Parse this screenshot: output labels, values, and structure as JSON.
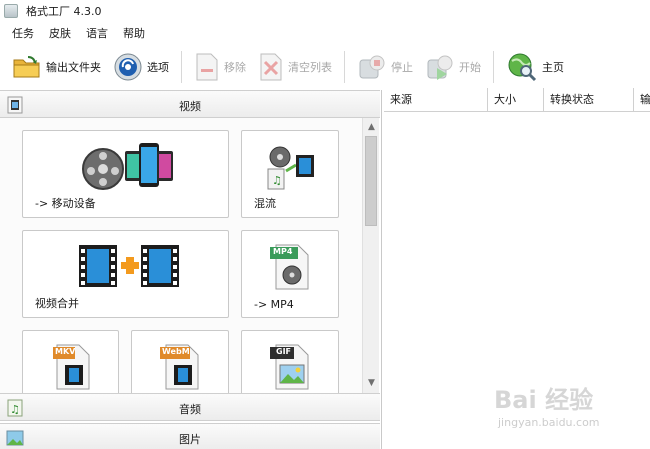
{
  "window": {
    "title": "格式工厂 4.3.0"
  },
  "menu": [
    "任务",
    "皮肤",
    "语言",
    "帮助"
  ],
  "toolbar": {
    "output_folder": "输出文件夹",
    "options": "选项",
    "remove": "移除",
    "clear_list": "清空列表",
    "stop": "停止",
    "start": "开始",
    "home": "主页"
  },
  "categories": {
    "video": "视频",
    "audio": "音频",
    "image": "图片"
  },
  "tiles": {
    "mobile": "-> 移动设备",
    "mux": "混流",
    "merge": "视频合并",
    "mp4": "-> MP4",
    "mp4_badge": "MP4",
    "mkv_badge": "MKV",
    "webm_badge": "WebM",
    "gif_badge": "GIF"
  },
  "table": {
    "columns": [
      "来源",
      "大小",
      "转换状态",
      "输"
    ]
  },
  "watermark": {
    "main": "Bai 经验",
    "sub": "jingyan.baidu.com"
  },
  "colors": {
    "accent_orange": "#f39a1e",
    "film_blue": "#2a8fd8",
    "disabled_text": "#a8a8a8"
  }
}
